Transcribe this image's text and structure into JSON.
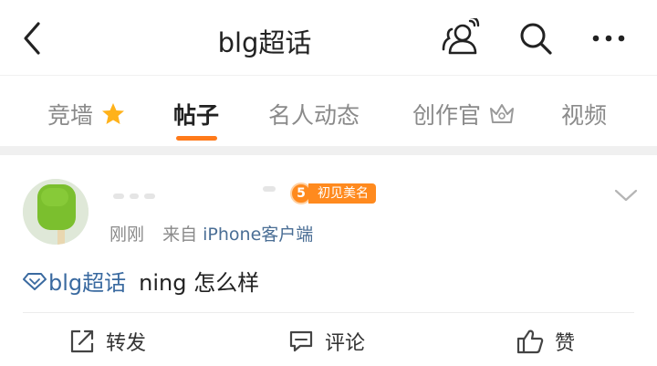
{
  "nav": {
    "title": "blg超话",
    "icons": [
      "back-arrow-icon",
      "people-icon",
      "search-icon",
      "more-icon"
    ]
  },
  "tabs": [
    {
      "label": "竞墙",
      "icon": "star-icon",
      "active": false
    },
    {
      "label": "帖子",
      "active": true
    },
    {
      "label": "名人动态",
      "active": false
    },
    {
      "label": "创作官",
      "icon": "crown-icon",
      "active": false
    },
    {
      "label": "视频",
      "active": false
    }
  ],
  "post": {
    "badge_level": "5",
    "badge_label": "初见美名",
    "time": "刚刚",
    "source_prefix": "来自",
    "source": "iPhone客户端",
    "topic": "blg超话",
    "text": "ning 怎么样"
  },
  "actions": {
    "repost": "转发",
    "comment": "评论",
    "like": "赞"
  },
  "colors": {
    "accent": "#ff7a1a",
    "link": "#4a6e95",
    "topic": "#3a6aa0",
    "badge": "#ff8a1e"
  }
}
